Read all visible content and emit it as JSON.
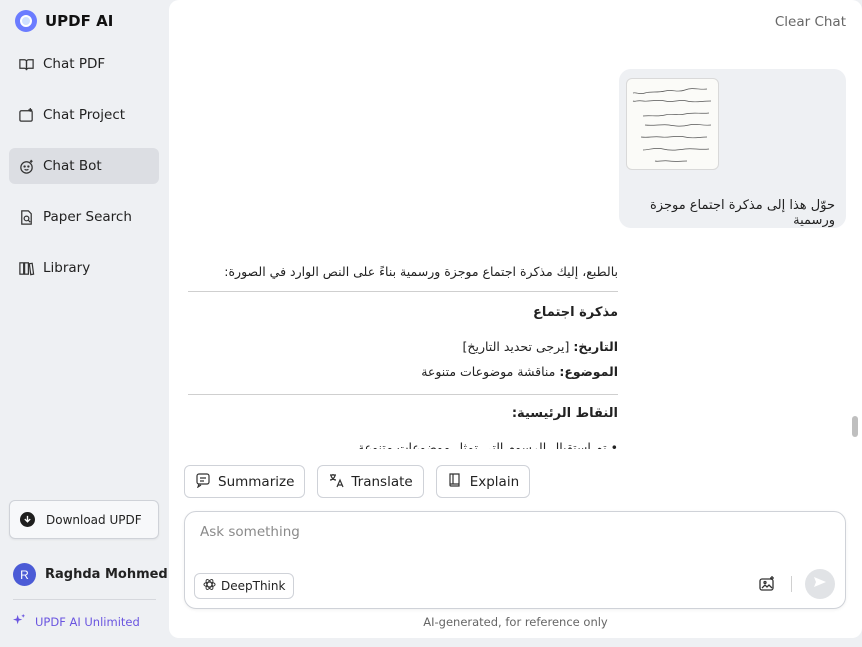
{
  "app": {
    "name": "UPDF AI"
  },
  "sidebar": {
    "items": [
      {
        "label": "Chat PDF",
        "icon": "book-open-icon"
      },
      {
        "label": "Chat Project",
        "icon": "folder-plus-icon"
      },
      {
        "label": "Chat Bot",
        "icon": "bot-face-icon",
        "active": true
      },
      {
        "label": "Paper Search",
        "icon": "document-search-icon"
      },
      {
        "label": "Library",
        "icon": "library-icon"
      }
    ],
    "download_label": "Download UPDF",
    "user": {
      "initial": "R",
      "name": "Raghda Mohmed"
    },
    "unlimited_label": "UPDF AI Unlimited"
  },
  "chat": {
    "clear_label": "Clear Chat",
    "user_message": "حوّل هذا إلى مذكرة اجتماع موجزة ورسمية",
    "answer": {
      "intro": "بالطبع، إليك مذكرة اجتماع موجزة ورسمية بناءً على النص الوارد في الصورة:",
      "heading": "مذكرة اجتماع",
      "date_label": "التاريخ:",
      "date_value": " [يرجى تحديد التاريخ]",
      "subject_label": "الموضوع:",
      "subject_value": " مناقشة موضوعات متنوعة",
      "points_heading": "النقاط الرئيسية:",
      "point_1": "• تم استقبال الرسوم التي تمثل موضوعات متنوعة"
    }
  },
  "actions": {
    "summarize": "Summarize",
    "translate": "Translate",
    "explain": "Explain"
  },
  "composer": {
    "placeholder": "Ask something",
    "deepthink_label": "DeepThink"
  },
  "footnote": "AI-generated, for reference only",
  "colors": {
    "accent": "#6a55e0",
    "avatar": "#4b5bd6",
    "active_nav": "#dcdee3"
  }
}
